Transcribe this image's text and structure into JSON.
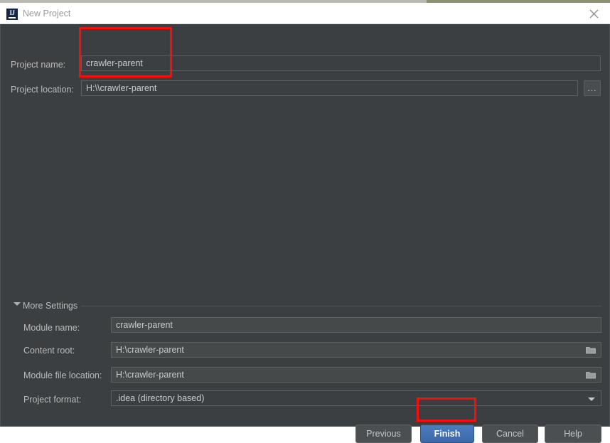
{
  "window": {
    "title": "New Project",
    "app_icon": "intellij-idea-icon",
    "close_icon": "close-icon"
  },
  "form": {
    "project_name": {
      "label": "Project name:",
      "value": "crawler-parent"
    },
    "project_location": {
      "label": "Project location:",
      "value": "H:\\\\crawler-parent",
      "browse_label": "...",
      "browse_icon": "ellipsis-browse-icon"
    }
  },
  "more_settings": {
    "label": "More Settings",
    "expanded": true,
    "toggle_icon": "chevron-down-icon",
    "fields": [
      {
        "name": "module-name",
        "label": "Module name:",
        "value": "crawler-parent",
        "control": "text",
        "trailing_icon": ""
      },
      {
        "name": "content-root",
        "label": "Content root:",
        "value": "H:\\crawler-parent",
        "control": "text",
        "trailing_icon": "folder-icon"
      },
      {
        "name": "module-file-location",
        "label": "Module file location:",
        "value": "H:\\crawler-parent",
        "control": "text",
        "trailing_icon": "folder-icon"
      },
      {
        "name": "project-format",
        "label": "Project format:",
        "value": ".idea (directory based)",
        "control": "combo",
        "trailing_icon": "chevron-down-icon"
      }
    ]
  },
  "footer": {
    "previous": "Previous",
    "finish": "Finish",
    "cancel": "Cancel",
    "help": "Help"
  },
  "colors": {
    "dialog_bg": "#3c3f41",
    "titlebar_bg": "#ffffff",
    "text": "#bbbbbb",
    "field_text": "#c8cbcd",
    "primary_button": "#4274b6",
    "annotation": "#fb0d0d"
  }
}
